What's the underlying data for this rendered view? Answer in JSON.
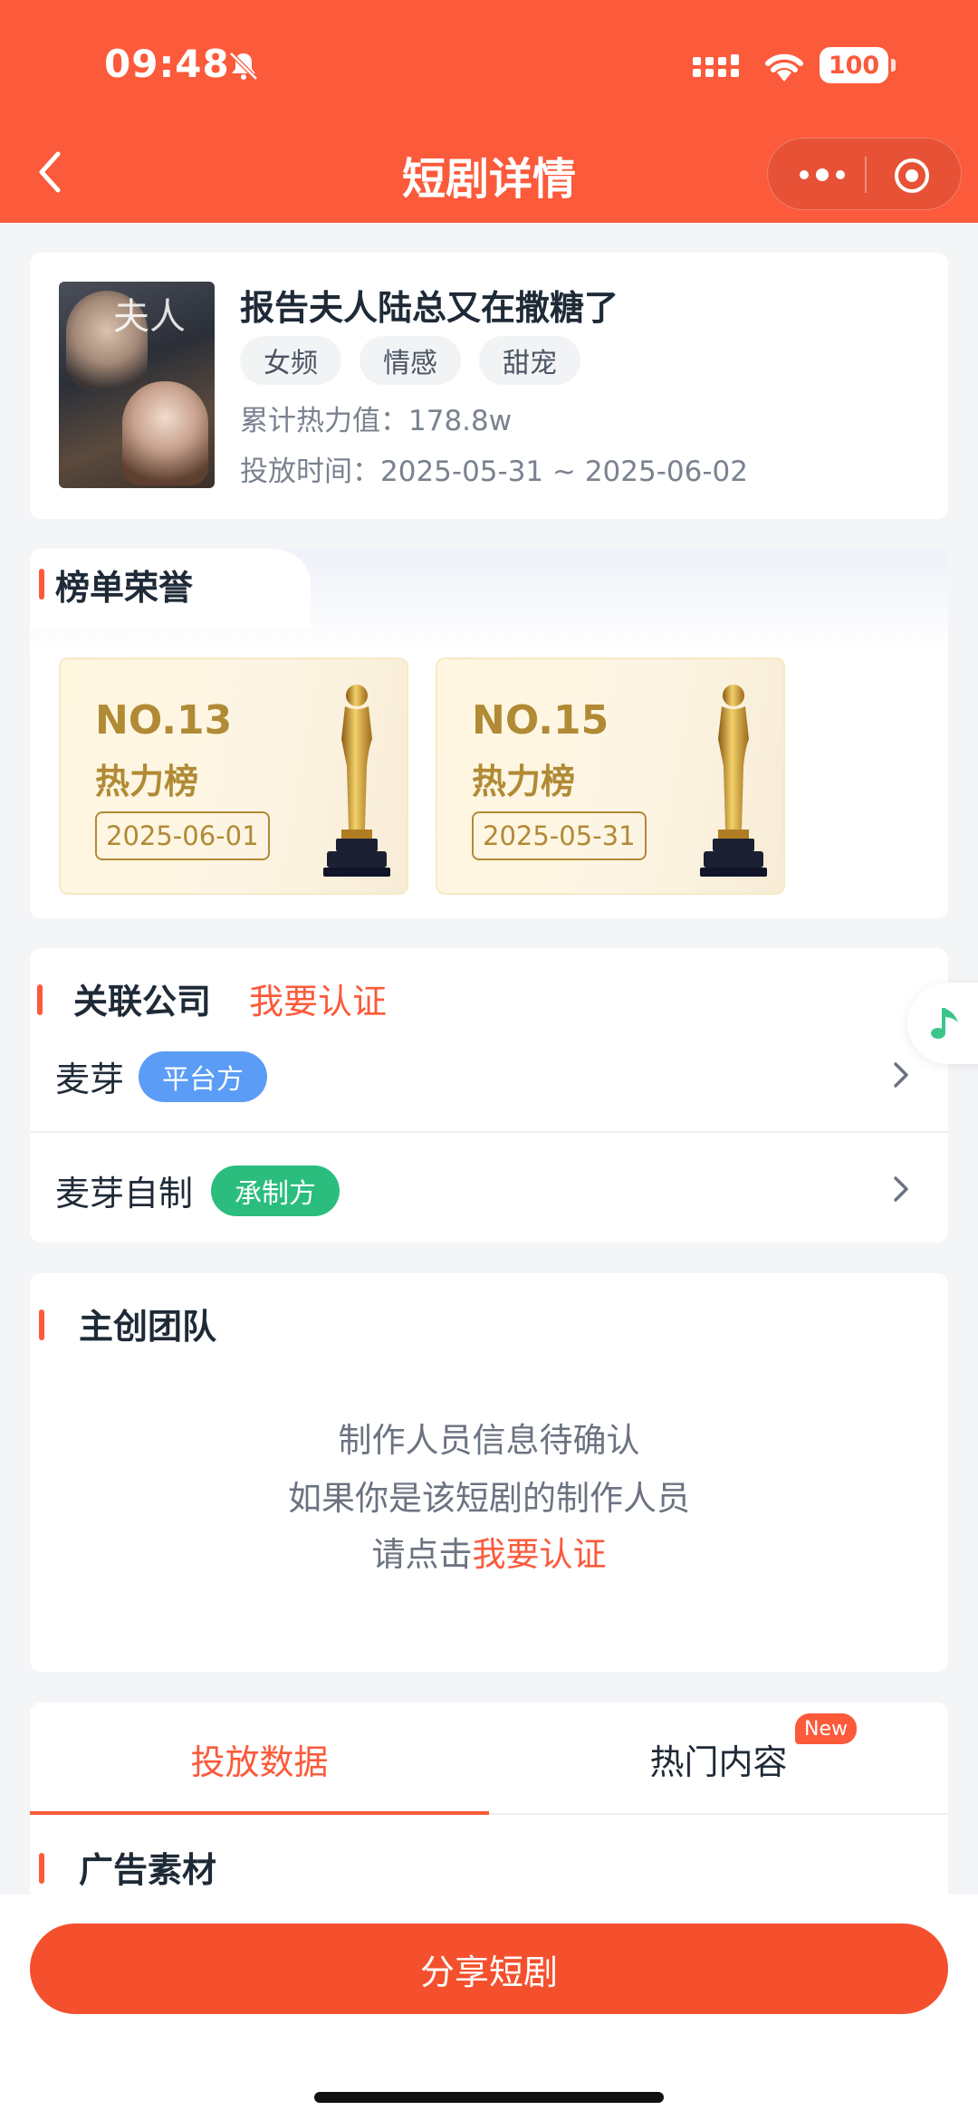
{
  "status_bar": {
    "time": "09:48",
    "battery": "100"
  },
  "nav": {
    "title": "短剧详情"
  },
  "drama": {
    "title": "报告夫人陆总又在撒糖了",
    "tags": [
      "女频",
      "情感",
      "甜宠"
    ],
    "heat": "累计热力值：178.8w",
    "period": "投放时间：2025-05-31 ~ 2025-06-02"
  },
  "honors": {
    "title": "榜单荣誉",
    "awards": [
      {
        "rank": "NO.13",
        "board": "热力榜",
        "date": "2025-06-01"
      },
      {
        "rank": "NO.15",
        "board": "热力榜",
        "date": "2025-05-31"
      }
    ]
  },
  "company": {
    "title": "关联公司",
    "cert_link": "我要认证",
    "rows": [
      {
        "name": "麦芽",
        "role": "平台方",
        "role_color": "#5b9cf6"
      },
      {
        "name": "麦芽自制",
        "role": "承制方",
        "role_color": "#2bbd7e"
      }
    ]
  },
  "team": {
    "title": "主创团队",
    "line1": "制作人员信息待确认",
    "line2": "如果你是该短剧的制作人员",
    "line3_prefix": "请点击",
    "line3_link": "我要认证"
  },
  "tabs": {
    "items": [
      "投放数据",
      "热门内容"
    ],
    "new_badge": "New",
    "section_title": "广告素材"
  },
  "bottom": {
    "share_label": "分享短剧"
  },
  "colors": {
    "accent": "#fb5a3b",
    "gold": "#b18a35"
  }
}
